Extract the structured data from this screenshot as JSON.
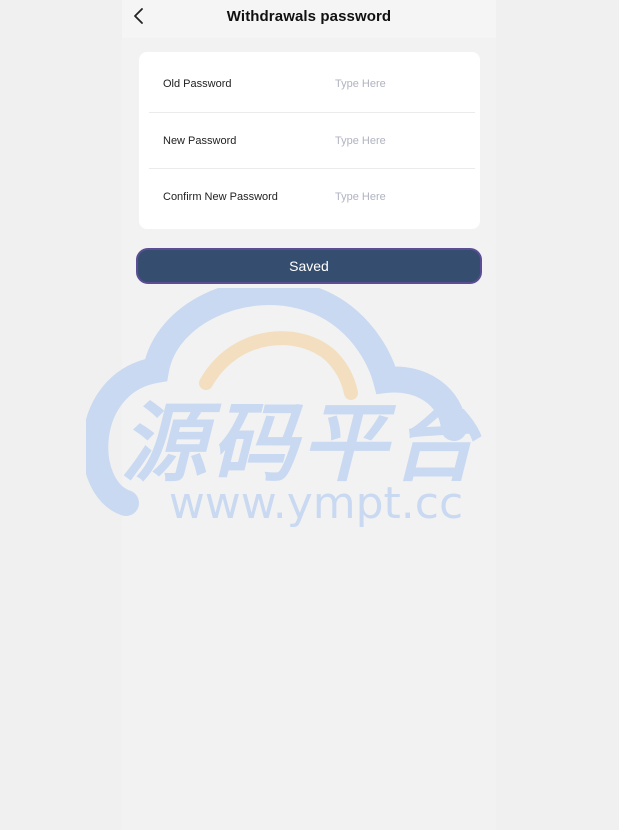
{
  "header": {
    "title": "Withdrawals password",
    "back_icon": "chevron-left-icon"
  },
  "form": {
    "fields": [
      {
        "label": "Old Password",
        "placeholder": "Type Here",
        "value": ""
      },
      {
        "label": "New Password",
        "placeholder": "Type Here",
        "value": ""
      },
      {
        "label": "Confirm New Password",
        "placeholder": "Type Here",
        "value": ""
      }
    ]
  },
  "actions": {
    "save_label": "Saved"
  },
  "watermark": {
    "chinese_text": "源码平台",
    "url_text": "www.ympt.cc"
  },
  "colors": {
    "button_bg": "#354d6e",
    "button_border": "#5b4e94",
    "placeholder": "#b0b3c0",
    "watermark_blue": "#c9d9f1",
    "watermark_orange": "#f3dfbf"
  }
}
